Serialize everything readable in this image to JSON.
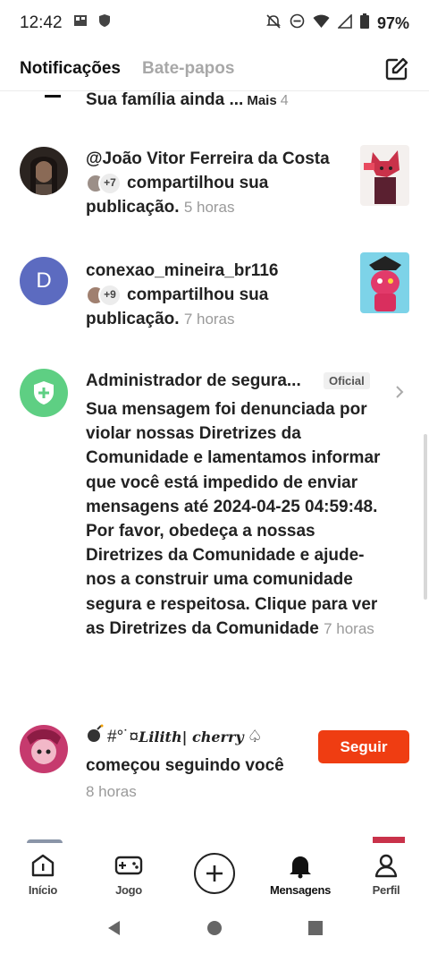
{
  "status_bar": {
    "time": "12:42",
    "battery": "97%",
    "left_icons": [
      "gallery-icon",
      "shield-icon"
    ],
    "right_icons": [
      "mute-icon",
      "dnd-icon",
      "wifi-icon",
      "signal-icon",
      "battery-icon"
    ]
  },
  "header": {
    "tabs": [
      {
        "label": "Notificações",
        "active": true
      },
      {
        "label": "Bate-papos",
        "active": false
      }
    ],
    "compose_icon": "compose-icon"
  },
  "feed": {
    "partial_item": {
      "text": "Sua família ainda ...",
      "more": "Mais",
      "count": "4"
    },
    "items": [
      {
        "type": "share",
        "name": "@João Vitor Ferreira da Costa",
        "extra_count": "+7",
        "action": "compartilhou sua publicação.",
        "time": "5 horas"
      },
      {
        "type": "share",
        "name": "conexao_mineira_br116",
        "avatar_letter": "D",
        "extra_count": "+9",
        "action": "compartilhou sua publicação.",
        "time": "7 horas"
      },
      {
        "type": "admin",
        "name": "Administrador de segura...",
        "badge": "Oficial",
        "message": "Sua mensagem foi denunciada por violar nossas Diretrizes da Comunidade e lamentamos informar que você está impedido de enviar mensagens até 2024-04-25 04:59:48. Por favor, obedeça a nossas Diretrizes da Comunidade e ajude-nos a construir uma comunidade segura e respeitosa. Clique para ver as Diretrizes da Comunidade",
        "time": "7 horas"
      },
      {
        "type": "follow",
        "name_prefix": "#°˙¤",
        "name_styled": "Lilith| cherry",
        "name_suffix": "♤",
        "action": "começou seguindo você",
        "time": "8 horas",
        "button": "Seguir"
      }
    ]
  },
  "bottom_nav": [
    {
      "label": "Início",
      "icon": "home-icon"
    },
    {
      "label": "Jogo",
      "icon": "gamepad-icon"
    },
    {
      "label": "",
      "icon": "plus-icon"
    },
    {
      "label": "Mensagens",
      "icon": "bell-icon",
      "active": true
    },
    {
      "label": "Perfil",
      "icon": "profile-icon"
    }
  ],
  "colors": {
    "accent": "#ef3d12",
    "official_shield": "#5ecf83",
    "letter_avatar": "#5c6bc0"
  }
}
